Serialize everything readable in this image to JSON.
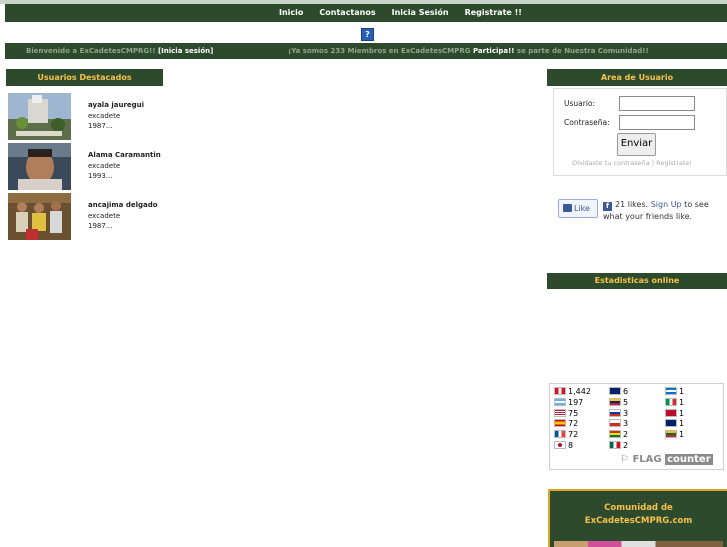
{
  "nav": {
    "items": [
      "Inicio",
      "Contactanos",
      "Inicia Sesión",
      "Registrate !!"
    ],
    "help_label": "?"
  },
  "welcome": {
    "left_prefix": "Bienvenido a ExCadetesCMPRG!! ",
    "left_link": "[Inicia sesión]",
    "right_prefix": "¡Ya somos 233 Miembros en ExCadetesCMPRG ",
    "right_link": "Participa!!",
    "right_suffix": " se parte de Nuestra Comunidad!!"
  },
  "featured": {
    "title": "Usuarios Destacados",
    "users": [
      {
        "name": "ayala jauregui",
        "role": "excadete",
        "year": "1987..."
      },
      {
        "name": "Alama Caramantin",
        "role": "excadete",
        "year": "1993..."
      },
      {
        "name": "ancajima delgado",
        "role": "excadete",
        "year": "1987..."
      }
    ]
  },
  "user_area": {
    "title": "Area de Usuario",
    "username_label": "Usuario:",
    "password_label": "Contraseña:",
    "username_value": "",
    "password_value": "",
    "submit_label": "Enviar",
    "forgot_label": "Olvidaste tu contraseña",
    "separator": " | ",
    "register_label": "Registrate!"
  },
  "facebook": {
    "like_label": "Like",
    "likes_text": "21 likes. ",
    "signup_label": "Sign Up",
    "suffix": " to see what your friends like."
  },
  "stats": {
    "title": "Estadisticas online"
  },
  "flag_counter": {
    "entries": [
      {
        "country": "pe",
        "count": "1,442"
      },
      {
        "country": "ar",
        "count": "197"
      },
      {
        "country": "us",
        "count": "75"
      },
      {
        "country": "es",
        "count": "72"
      },
      {
        "country": "fr",
        "count": "72"
      },
      {
        "country": "jp",
        "count": "8"
      },
      {
        "country": "au",
        "count": "6"
      },
      {
        "country": "ve",
        "count": "5"
      },
      {
        "country": "ru",
        "count": "3"
      },
      {
        "country": "cl",
        "count": "3"
      },
      {
        "country": "bo",
        "count": "2"
      },
      {
        "country": "mx",
        "count": "2"
      },
      {
        "country": "hn",
        "count": "1"
      },
      {
        "country": "it",
        "count": "1"
      },
      {
        "country": "no",
        "count": "1"
      },
      {
        "country": "gb",
        "count": "1"
      },
      {
        "country": "lt",
        "count": "1"
      }
    ],
    "logo_flag": "FLAG",
    "logo_counter": "counter"
  },
  "community": {
    "line1": "Comunidad de",
    "line2": "ExCadetesCMPRG.com"
  },
  "colors": {
    "bar_green": "#2d4a2d",
    "header_gold": "#f6c24a",
    "facebook_blue": "#3b5998"
  }
}
